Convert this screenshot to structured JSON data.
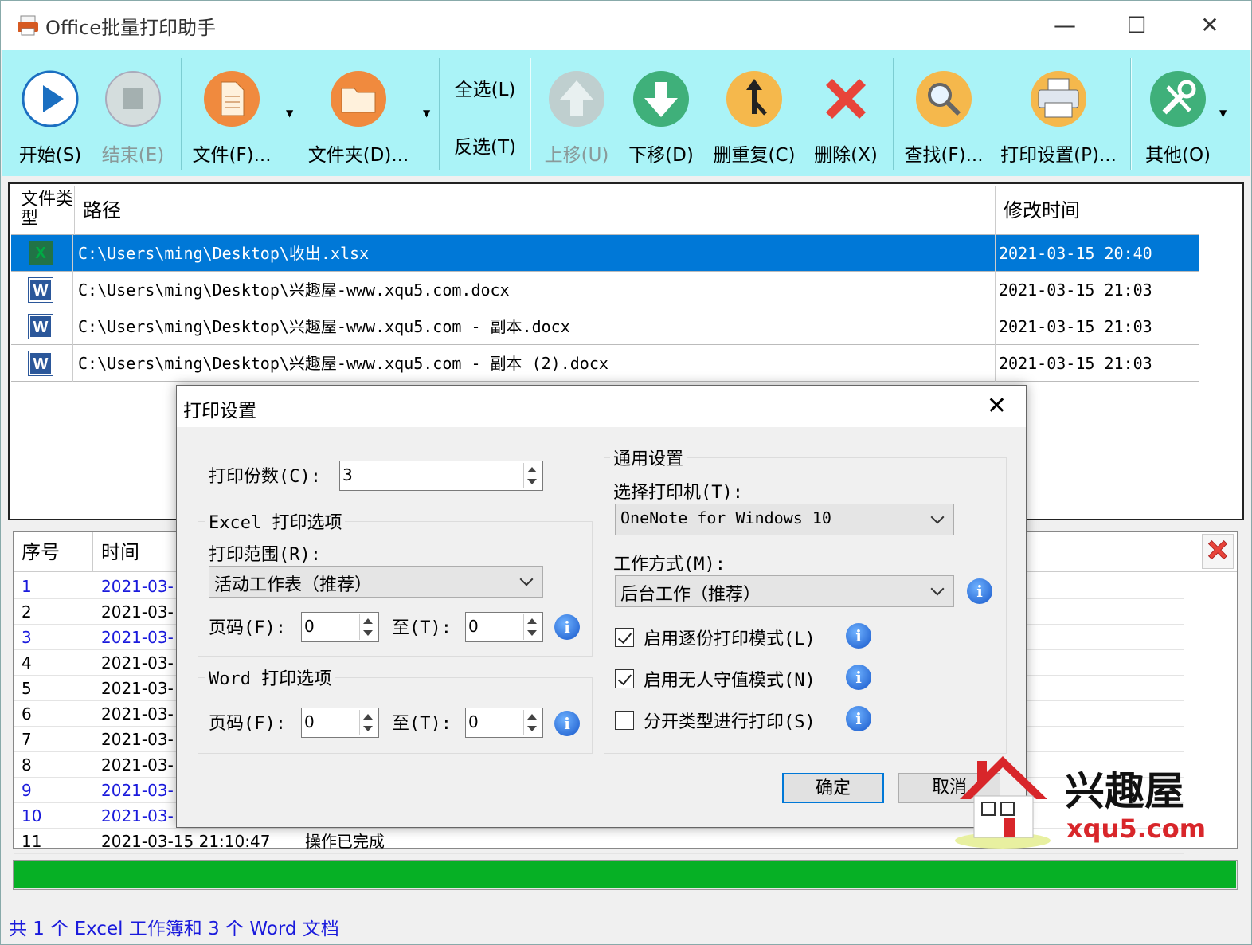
{
  "window": {
    "title": "Office批量打印助手"
  },
  "toolbar": {
    "start": "开始(S)",
    "stop": "结束(E)",
    "file": "文件(F)...",
    "folder": "文件夹(D)...",
    "select_all": "全选(L)",
    "invert": "反选(T)",
    "move_up": "上移(U)",
    "move_down": "下移(D)",
    "dedupe": "删重复(C)",
    "delete": "删除(X)",
    "find": "查找(F)...",
    "print_settings": "打印设置(P)...",
    "other": "其他(O)"
  },
  "filelist": {
    "headers": {
      "type": "文件类型",
      "path": "路径",
      "mtime": "修改时间"
    },
    "rows": [
      {
        "type": "X",
        "path": "C:\\Users\\ming\\Desktop\\收出.xlsx",
        "mtime": "2021-03-15 20:40"
      },
      {
        "type": "W",
        "path": "C:\\Users\\ming\\Desktop\\兴趣屋-www.xqu5.com.docx",
        "mtime": "2021-03-15 21:03"
      },
      {
        "type": "W",
        "path": "C:\\Users\\ming\\Desktop\\兴趣屋-www.xqu5.com - 副本.docx",
        "mtime": "2021-03-15 21:03"
      },
      {
        "type": "W",
        "path": "C:\\Users\\ming\\Desktop\\兴趣屋-www.xqu5.com - 副本 (2).docx",
        "mtime": "2021-03-15 21:03"
      }
    ]
  },
  "log": {
    "headers": {
      "seq": "序号",
      "time": "时间"
    },
    "rows": [
      {
        "seq": "1",
        "time": "2021-03-",
        "msg": ""
      },
      {
        "seq": "2",
        "time": "2021-03-",
        "msg": ""
      },
      {
        "seq": "3",
        "time": "2021-03-",
        "msg": ""
      },
      {
        "seq": "4",
        "time": "2021-03-",
        "msg": ""
      },
      {
        "seq": "5",
        "time": "2021-03-",
        "msg": ""
      },
      {
        "seq": "6",
        "time": "2021-03-",
        "msg": ""
      },
      {
        "seq": "7",
        "time": "2021-03-",
        "msg": ""
      },
      {
        "seq": "8",
        "time": "2021-03-",
        "msg": ""
      },
      {
        "seq": "9",
        "time": "2021-03-",
        "msg": ""
      },
      {
        "seq": "10",
        "time": "2021-03-",
        "msg": ""
      },
      {
        "seq": "11",
        "time": "2021-03-15 21:10:47",
        "msg": "操作已完成"
      }
    ]
  },
  "progress": {
    "percent": 100,
    "color": "#06b025"
  },
  "status": {
    "text": "共 1 个 Excel 工作簿和 3 个 Word 文档"
  },
  "dialog": {
    "title": "打印设置",
    "copies_label": "打印份数(C):",
    "copies_value": "3",
    "excel_group": "Excel 打印选项",
    "range_label": "打印范围(R):",
    "range_value": "活动工作表（推荐）",
    "page_label": "页码(F):",
    "to_label": "至(T):",
    "excel_from": "0",
    "excel_to": "0",
    "word_group": "Word 打印选项",
    "word_from": "0",
    "word_to": "0",
    "general_group": "通用设置",
    "printer_label": "选择打印机(T):",
    "printer_value": "OneNote for Windows 10",
    "mode_label": "工作方式(M):",
    "mode_value": "后台工作（推荐）",
    "collate_label": "启用逐份打印模式(L)",
    "unattended_label": "启用无人守值模式(N)",
    "separate_label": "分开类型进行打印(S)",
    "ok": "确定",
    "cancel": "取消"
  },
  "watermark": {
    "brand": "兴趣屋",
    "domain": "xqu5.com"
  }
}
